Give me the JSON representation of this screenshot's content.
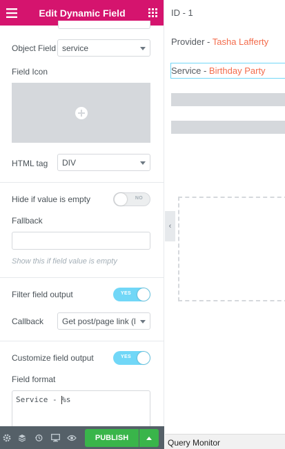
{
  "panel": {
    "title": "Edit Dynamic Field",
    "object_field": {
      "label": "Object Field",
      "value": "service"
    },
    "field_icon": {
      "label": "Field Icon"
    },
    "html_tag": {
      "label": "HTML tag",
      "value": "DIV"
    },
    "hide_if_empty": {
      "label": "Hide if value is empty",
      "toggle": "NO"
    },
    "fallback": {
      "label": "Fallback",
      "value": "",
      "hint": "Show this if field value is empty"
    },
    "filter_output": {
      "label": "Filter field output",
      "toggle": "YES"
    },
    "callback": {
      "label": "Callback",
      "value": "Get post/page link (l"
    },
    "customize_output": {
      "label": "Customize field output",
      "toggle": "YES"
    },
    "field_format": {
      "label": "Field format",
      "before_cursor": "Service - ",
      "after_cursor": "%s"
    }
  },
  "footer": {
    "publish_label": "PUBLISH"
  },
  "preview": {
    "id_line": "ID - 1",
    "provider_prefix": "Provider - ",
    "provider_value": "Tasha Lafferty",
    "service_prefix": "Service - ",
    "service_value": "Birthday Party"
  },
  "query_monitor": "Query Monitor",
  "colors": {
    "header": "#d5146e",
    "accent": "#f36c4c",
    "toggle_on": "#71d7f7",
    "publish": "#39b54a",
    "footer": "#556068"
  },
  "icons": [
    "hamburger-icon",
    "apps-grid-icon",
    "plus-icon",
    "settings-icon",
    "layers-icon",
    "history-icon",
    "responsive-icon",
    "preview-eye-icon",
    "chevron-up-icon",
    "chevron-left-icon"
  ]
}
